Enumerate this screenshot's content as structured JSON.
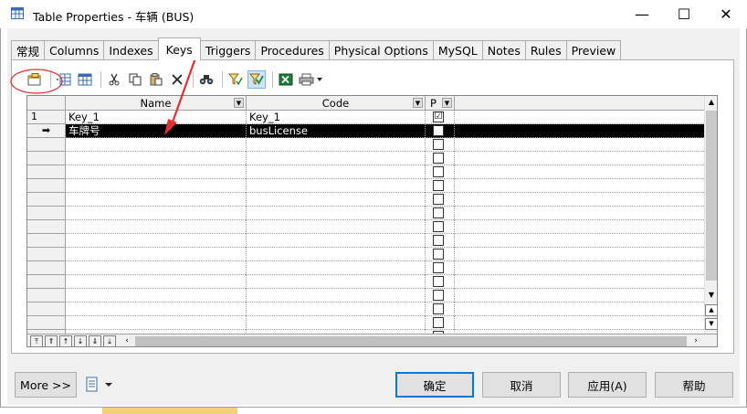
{
  "window": {
    "title": "Table Properties - 车辆 (BUS)",
    "minimize_glyph": "—",
    "maximize_glyph": "☐",
    "close_glyph": "✕"
  },
  "tabs": [
    {
      "label": "常规"
    },
    {
      "label": "Columns"
    },
    {
      "label": "Indexes"
    },
    {
      "label": "Keys",
      "active": true
    },
    {
      "label": "Triggers"
    },
    {
      "label": "Procedures"
    },
    {
      "label": "Physical Options"
    },
    {
      "label": "MySQL"
    },
    {
      "label": "Notes"
    },
    {
      "label": "Rules"
    },
    {
      "label": "Preview"
    }
  ],
  "toolbar": {
    "icons": [
      "properties-icon",
      "insert-row-icon",
      "add-row-icon",
      "cut-icon",
      "copy-icon",
      "paste-icon",
      "delete-icon",
      "find-icon",
      "filter-icon",
      "customize-columns-icon",
      "excel-export-icon",
      "print-icon"
    ]
  },
  "grid": {
    "columns": [
      {
        "label": "Name"
      },
      {
        "label": "Code"
      },
      {
        "label": "P"
      }
    ],
    "rows": [
      {
        "row_header": "1",
        "name": "Key_1",
        "code": "Key_1",
        "primary": "☑"
      },
      {
        "row_header": "➡",
        "name": "车牌号",
        "code": "busLicense",
        "primary": ""
      }
    ],
    "empty_row_count": 15
  },
  "buttons": {
    "more": "More >>",
    "ok": "确定",
    "cancel": "取消",
    "apply": "应用(A)",
    "help": "帮助"
  },
  "colors": {
    "selected_row_bg": "#000000",
    "annotation_red": "#e03030",
    "default_button_border": "#0078d7"
  }
}
